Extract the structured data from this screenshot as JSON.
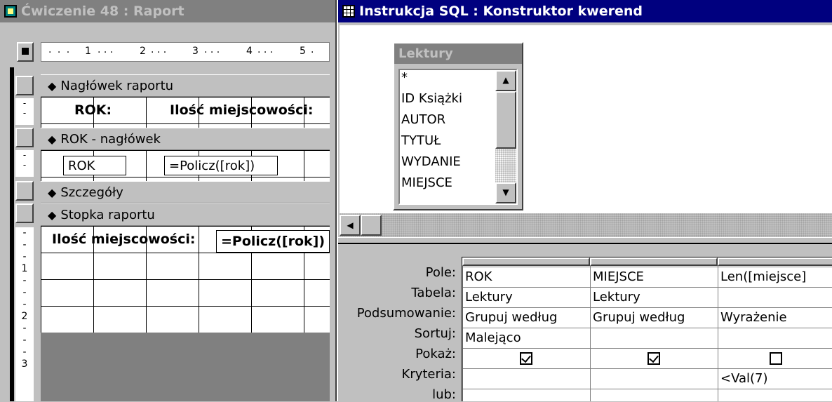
{
  "report_window": {
    "title": "Ćwiczenie 48 : Raport",
    "ruler_marks": [
      "1",
      "2",
      "3",
      "4",
      "5"
    ],
    "left_ruler_marks": [
      "1",
      "2",
      "3"
    ],
    "sections": {
      "report_header": "Nagłówek raportu",
      "group_header": "ROK - nagłówek",
      "details": "Szczegóły",
      "report_footer": "Stopka raportu"
    },
    "controls": {
      "rok_label": "ROK:",
      "count_label": "Ilość miejscowości:",
      "rok_field": "ROK",
      "count_expr": "=Policz([rok])",
      "footer_label": "Ilość miejscowości:",
      "footer_expr": "=Policz([rok])"
    }
  },
  "query_window": {
    "title": "Instrukcja SQL : Konstruktor kwerend",
    "table": {
      "name": "Lektury",
      "fields": [
        "*",
        "ID Książki",
        "AUTOR",
        "TYTUŁ",
        "WYDANIE",
        "MIEJSCE"
      ]
    },
    "grid": {
      "row_labels": [
        "Pole:",
        "Tabela:",
        "Podsumowanie:",
        "Sortuj:",
        "Pokaż:",
        "Kryteria:",
        "lub:"
      ],
      "columns": [
        {
          "pole": "ROK",
          "tabela": "Lektury",
          "podsumowanie": "Grupuj według",
          "sortuj": "Malejąco",
          "pokaz": true,
          "kryteria": ""
        },
        {
          "pole": "MIEJSCE",
          "tabela": "Lektury",
          "podsumowanie": "Grupuj według",
          "sortuj": "",
          "pokaz": true,
          "kryteria": ""
        },
        {
          "pole": "Len([miejsce]",
          "tabela": "",
          "podsumowanie": "Wyrażenie",
          "sortuj": "",
          "pokaz": false,
          "kryteria": "<Val(7)"
        }
      ]
    }
  },
  "colors": {
    "active_title": "#00007f",
    "inactive_title": "#808080",
    "face": "#c0c0c0"
  }
}
